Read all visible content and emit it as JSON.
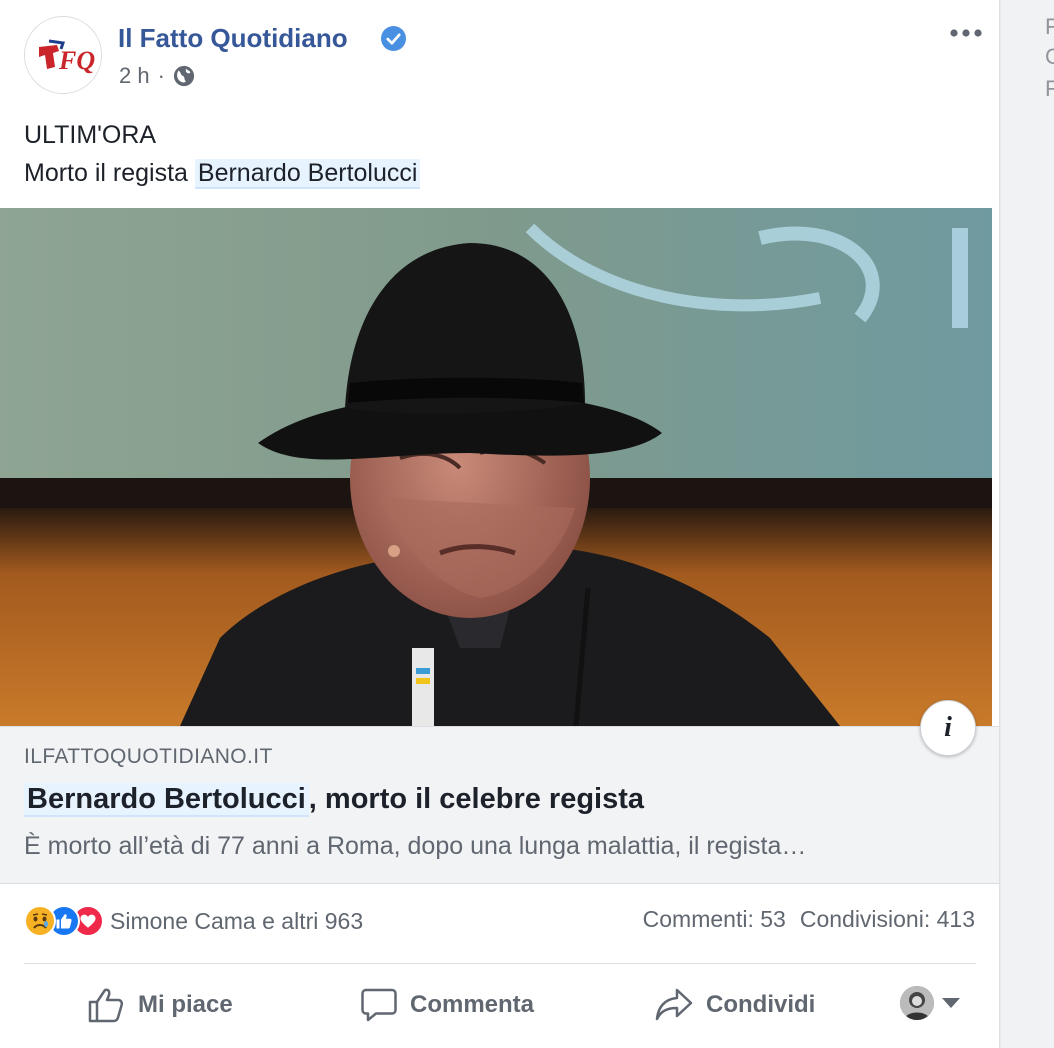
{
  "post": {
    "page_name": "Il Fatto Quotidiano",
    "logo_text": "FQ",
    "time": "2 h",
    "separator": "·",
    "text_line1": "ULTIM'ORA",
    "text_line2_prefix": "Morto il regista ",
    "text_line2_link": "Bernardo Bertolucci"
  },
  "link": {
    "domain": "ILFATTOQUOTIDIANO.IT",
    "title_highlight": "Bernardo Bertolucci",
    "title_rest": ", morto il celebre regista",
    "description": "È morto all’età di 77 anni a Roma, dopo una lunga malattia, il regista…",
    "info_label": "i"
  },
  "stats": {
    "reactions_text": "Simone Cama e altri 963",
    "comments": "Commenti: 53",
    "shares": "Condivisioni: 413"
  },
  "actions": {
    "like": "Mi piace",
    "comment": "Commenta",
    "share": "Condividi"
  },
  "right_column": {
    "letters": [
      "F",
      "C",
      "F"
    ]
  },
  "colors": {
    "brand_link": "#365899",
    "verified": "#4a90e2",
    "like_blue": "#1877f2",
    "love_red": "#f0284a",
    "sad_yellow": "#f7b125"
  },
  "icons": [
    "verified-badge-icon",
    "globe-icon",
    "more-options-icon",
    "info-icon",
    "sad-reaction-icon",
    "like-reaction-icon",
    "love-reaction-icon",
    "thumbs-up-icon",
    "comment-icon",
    "share-icon",
    "caret-down-icon"
  ]
}
